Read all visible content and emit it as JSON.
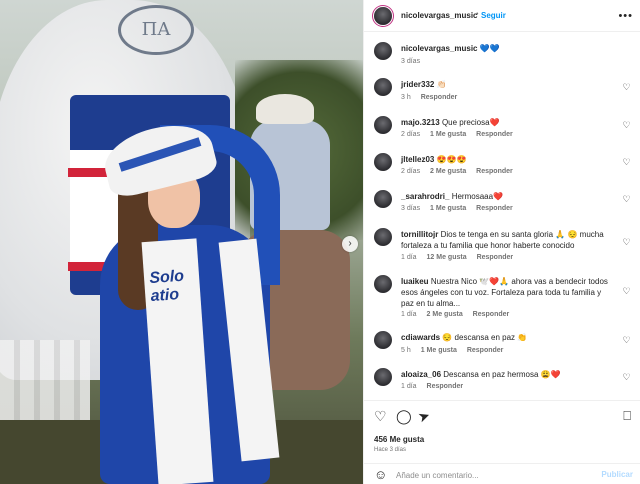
{
  "post": {
    "author": "nicolevargas_music",
    "follow_label": "Seguir",
    "more_icon": "more-horizontal-icon",
    "caption": {
      "username": "nicolevargas_music",
      "text": "💙💙",
      "time": "3 días"
    },
    "photo": {
      "logo_text": "ΠΑ",
      "scarf_text_1": "Solo",
      "scarf_text_2": "atio"
    },
    "next_icon": "chevron-right-icon"
  },
  "comments": [
    {
      "username": "jrider332",
      "text": "👏🏻",
      "time": "3 h",
      "likes": "",
      "reply": "Responder"
    },
    {
      "username": "majo.3213",
      "text": "Que preciosa❤️",
      "time": "2 días",
      "likes": "1 Me gusta",
      "reply": "Responder"
    },
    {
      "username": "jltellez03",
      "text": "😍😍😍",
      "time": "2 días",
      "likes": "2 Me gusta",
      "reply": "Responder"
    },
    {
      "username": "_sarahrodri_",
      "text": "Hermosaaa❤️",
      "time": "3 días",
      "likes": "1 Me gusta",
      "reply": "Responder"
    },
    {
      "username": "tornillitojr",
      "text": "Dios te tenga en su santa gloria 🙏 😔 mucha fortaleza a tu familia que honor haberte conocido",
      "time": "1 día",
      "likes": "12 Me gusta",
      "reply": "Responder"
    },
    {
      "username": "luaikeu",
      "text": "Nuestra Nico 🕊️❤️🙏 ahora vas a bendecir todos esos ángeles con tu voz. Fortaleza para toda tu familia y paz en tu alma...",
      "time": "1 día",
      "likes": "2 Me gusta",
      "reply": "Responder"
    },
    {
      "username": "cdiawards",
      "text": "😔 descansa en paz 👏",
      "time": "5 h",
      "likes": "1 Me gusta",
      "reply": "Responder"
    },
    {
      "username": "aloaiza_06",
      "text": "Descansa en paz hermosa 😩❤️",
      "time": "1 día",
      "likes": "",
      "reply": "Responder"
    }
  ],
  "actions": {
    "like_icon": "heart-icon",
    "comment_icon": "comment-icon",
    "share_icon": "send-icon",
    "save_icon": "bookmark-icon"
  },
  "likes_text": "456 Me gusta",
  "posted_when": "Hace 3 días",
  "comment_box": {
    "emoji_icon": "emoji-icon",
    "placeholder": "Añade un comentario...",
    "post_label": "Publicar"
  },
  "colors": {
    "link": "#0095f6",
    "text": "#262626",
    "muted": "#737373",
    "publish_disabled": "#b3dbff",
    "heart_red": "#ed4956"
  }
}
